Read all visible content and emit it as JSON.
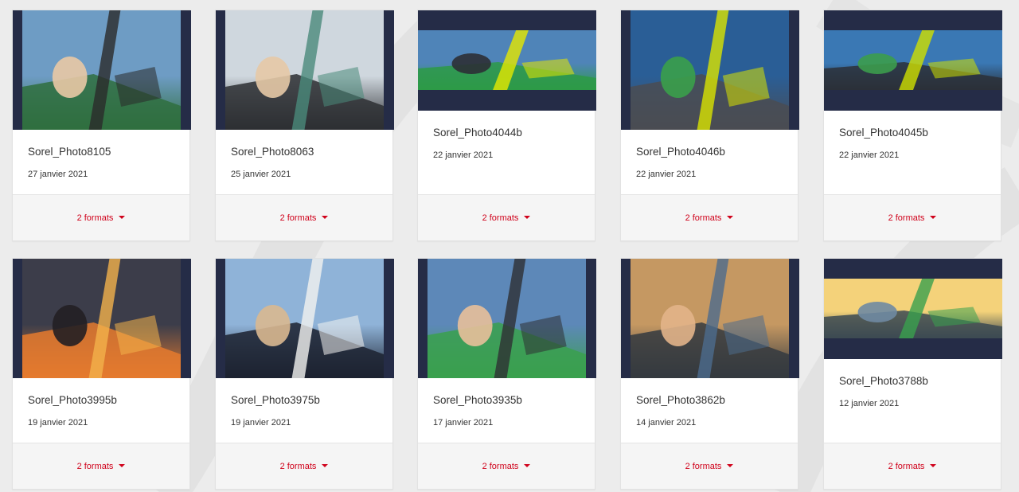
{
  "gallery": {
    "items": [
      {
        "title": "Sorel_Photo8105",
        "date": "27 janvier 2021",
        "formats": "2 formats",
        "orientation": "portrait",
        "palette": [
          "#6e9cc4",
          "#2f6f3e",
          "#2a2a2a",
          "#e9c9a5"
        ]
      },
      {
        "title": "Sorel_Photo8063",
        "date": "25 janvier 2021",
        "formats": "2 formats",
        "orientation": "portrait",
        "palette": [
          "#cfd7de",
          "#2d2f33",
          "#4a8a7a",
          "#e6c9a6"
        ]
      },
      {
        "title": "Sorel_Photo4044b",
        "date": "22 janvier 2021",
        "formats": "2 formats",
        "orientation": "landscape",
        "palette": [
          "#4f84b8",
          "#2d9a46",
          "#e5e800",
          "#2c2f35"
        ]
      },
      {
        "title": "Sorel_Photo4046b",
        "date": "22 janvier 2021",
        "formats": "2 formats",
        "orientation": "portrait",
        "palette": [
          "#2a5e96",
          "#4a4c52",
          "#d9e400",
          "#3aa04a"
        ]
      },
      {
        "title": "Sorel_Photo4045b",
        "date": "22 janvier 2021",
        "formats": "2 formats",
        "orientation": "landscape",
        "palette": [
          "#3a78b4",
          "#2b3038",
          "#cfe000",
          "#3c9c4c"
        ]
      },
      {
        "title": "Sorel_Photo3995b",
        "date": "19 janvier 2021",
        "formats": "2 formats",
        "orientation": "portrait",
        "palette": [
          "#3c3d4a",
          "#e57a2e",
          "#f2b24b",
          "#221f24"
        ]
      },
      {
        "title": "Sorel_Photo3975b",
        "date": "19 janvier 2021",
        "formats": "2 formats",
        "orientation": "portrait",
        "palette": [
          "#8fb3d8",
          "#1c2230",
          "#f2f2f0",
          "#d9b890"
        ]
      },
      {
        "title": "Sorel_Photo3935b",
        "date": "17 janvier 2021",
        "formats": "2 formats",
        "orientation": "portrait",
        "palette": [
          "#5d88b8",
          "#3aa04e",
          "#2e2f33",
          "#e8c09a"
        ]
      },
      {
        "title": "Sorel_Photo3862b",
        "date": "14 janvier 2021",
        "formats": "2 formats",
        "orientation": "portrait",
        "palette": [
          "#c59862",
          "#34393f",
          "#4c6b8d",
          "#e2b48a"
        ]
      },
      {
        "title": "Sorel_Photo3788b",
        "date": "12 janvier 2021",
        "formats": "2 formats",
        "orientation": "landscape",
        "palette": [
          "#f4d27a",
          "#3c4a52",
          "#3aa04e",
          "#6f8aa2"
        ]
      }
    ],
    "caret_icon": "caret-down-icon",
    "colors": {
      "accent": "#d0021b",
      "thumb_bg": "#252c47",
      "footer_bg": "#f5f5f5"
    }
  }
}
